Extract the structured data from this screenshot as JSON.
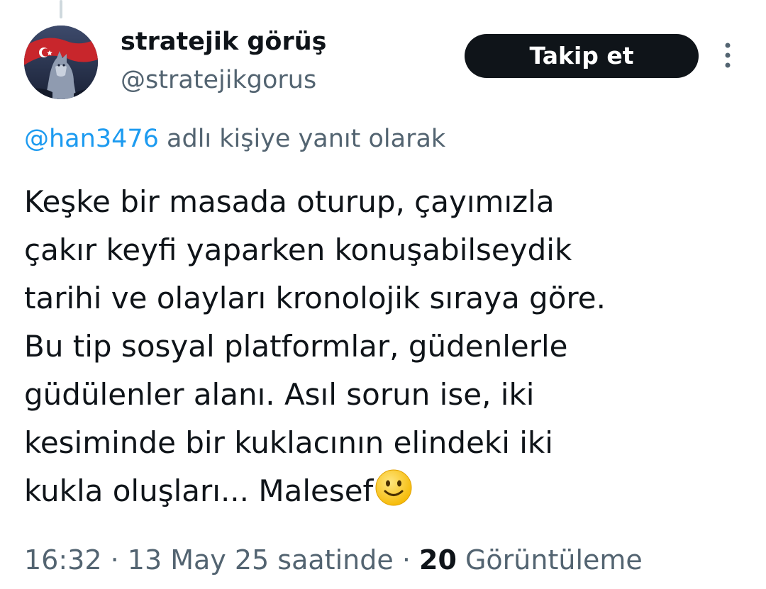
{
  "author": {
    "display_name": "stratejik görüş",
    "handle": "@stratejikgorus",
    "avatar_icon": "wolf-flag-avatar"
  },
  "follow_button": {
    "label": "Takip et"
  },
  "more_menu": {
    "icon": "more-vertical-icon"
  },
  "reply_context": {
    "handle": "@han3476",
    "suffix": "adlı kişiye yanıt olarak"
  },
  "tweet": {
    "lines": [
      "Keşke bir masada oturup, çayımızla",
      "çakır keyfi yaparken konuşabilseydik",
      "tarihi ve olayları kronolojik sıraya göre.",
      "Bu tip sosyal platformlar, güdenlerle",
      "güdülenler alanı. Asıl sorun ise, iki",
      "kesiminde bir kuklacının elindeki iki",
      "kukla oluşları... Malesef"
    ],
    "emoji": "slightly-smiling-face-icon"
  },
  "meta": {
    "time": "16:32",
    "separator": "·",
    "date": "13 May 25 saatinde",
    "views_count": "20",
    "views_label": "Görüntüleme"
  },
  "colors": {
    "text_primary": "#0f1419",
    "text_secondary": "#536471",
    "link": "#1d9bf0",
    "button_bg": "#0f1419",
    "button_text": "#ffffff"
  }
}
